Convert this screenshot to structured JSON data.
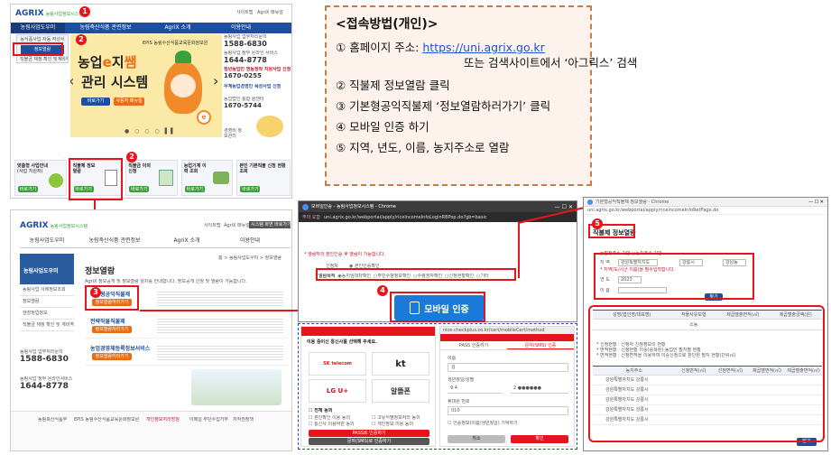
{
  "panel1": {
    "logo": "AGRIX",
    "logo_sub": "농림사업정보시스템",
    "top_links": [
      "사이트맵",
      "AgriX 매뉴얼"
    ],
    "nav": [
      "농림사업도우미",
      "농림축산식품 관련정보",
      "AgriX 소개",
      "이용안내"
    ],
    "dropdown": [
      "농식품사업 자동 작성서",
      "정보열람",
      "직불금 재정 확인 및계비역 관리"
    ],
    "hero_line1": "농업",
    "hero_e": "e",
    "hero_line1b": "지",
    "hero_ssam": "쌤",
    "hero_line2": "관리 시스템",
    "hero_btn1": "바로가기",
    "hero_btn2": "사용자 매뉴얼",
    "hero_brand": "EPIS 농림수산식품교육문화정보원",
    "contact_label1": "농림사업 업무처리문의",
    "contact_phone1": "1588-6830",
    "contact_label2": "농림사업 정부 온라인 서비스",
    "contact_phone2": "1644-8778",
    "contact_label3": "청년농업인 영농정착 지원사업 신청",
    "contact_phone3": "1670-0255",
    "contact_label4": "우계농업경영인 육성사업 신청",
    "contact_label5": "농업법인 통합 콜센터",
    "contact_phone5": "1670-5744",
    "side_icon_label": "경영비 정보관리",
    "tiles": [
      {
        "title": "맞춤형 사업안내",
        "sub": "(사업 지원처)",
        "btn": "바로가기"
      },
      {
        "title": "직불제 정보열람",
        "sub": "",
        "btn": "바로가기"
      },
      {
        "title": "직불금 이의신청",
        "sub": "",
        "btn": "바로가기"
      },
      {
        "title": "농업기계 이력 조회",
        "sub": "",
        "btn": "바로가기"
      },
      {
        "title": "본인 기본직불 신청 현황 조회",
        "sub": "",
        "btn": "바로가기"
      }
    ]
  },
  "panel2": {
    "logo": "AGRIX",
    "logo_sub": "농림사업정보시스템",
    "top_links": [
      "사이트맵",
      "AgriX 매뉴얼",
      "시스템 화면 바로가기"
    ],
    "nav": [
      "농림사업도우미",
      "농림축산식품 관련정보",
      "AgriX 소개",
      "이용안내"
    ],
    "side_title": "농림사업도우미",
    "side_items": [
      "농림사업 사례정보조회",
      "정보열람",
      "현장정업정보",
      "직불금 재정 확인 및 계비역"
    ],
    "content_title": "정보열람",
    "breadcrumb": "홈 > 농림사업도우미 > 정보열람",
    "intro": "AgriX 정보공개 및 정보열람 절차를 안내합니다. 정보공개 신청 및 열람이 가능합니다.",
    "items": [
      {
        "title": "기본형공익직불제",
        "btn": "정보열람하러가기"
      },
      {
        "title": "전략작물직불제",
        "btn": "정보열람하러가기"
      },
      {
        "title": "농업경영체등록정보서비스",
        "btn": "정보열람하러가기"
      }
    ],
    "phone_label1": "농림사업 업무처리문의",
    "phone1": "1588-6830",
    "phone_label2": "농림사업 정부 온라인서비스",
    "phone2": "1644-8778",
    "footer_org1": "농림축산식품부",
    "footer_org2": "EPIS 농림수산식품교육문화정보원",
    "footer_links": [
      "개인정보처리방침",
      "이메일 무단수집거부",
      "저작권정책"
    ]
  },
  "panel3": {
    "window_title": "모바일인증 - 농림사업정보시스템 - Chrome",
    "security": "주의 요함",
    "url": "uni.agrix.go.kr/webportal/apply/ricelncomeInfoLoginRBPop.do?gb=basic",
    "notice": "* 열람자의 본인인증 후 열람이 가능합니다.",
    "radio_label1": "신청자",
    "radio1": "본인인증확인",
    "radio_label2": "열람목적",
    "radios": [
      "농지임대차확인",
      "주민수향정보확인",
      "수령권자확인",
      "신청현황확인",
      "기타"
    ],
    "mobile_btn": "모바일 인증"
  },
  "panel4": {
    "left_logo": "PASS",
    "left_prompt": "이용 중이신 통신사를 선택해 주세요.",
    "carriers": [
      "SK telecom",
      "kt",
      "LG U+",
      "알뜰폰"
    ],
    "agree_all": "전체 동의",
    "agree_items": [
      "본인확인 이용 동의",
      "고유식별정보처리 동의",
      "통신사 이용약관 동의",
      "개인정보 이용 동의"
    ],
    "left_btn": "PASS로 인증하기",
    "left_btn2": "문자(SMS)로 인증하기",
    "url": "nice.checkplus.co.kr/cert/mobileCert/method",
    "tab1": "PASS 인증하기",
    "tab2": "문자(SMS) 인증",
    "field_name": "이름",
    "field_name_val": "김",
    "field_birth": "생년월일/성별",
    "field_birth_val": "9 4",
    "field_birth_mask": "2 ●●●●●●",
    "field_phone": "휴대폰 번호",
    "field_phone_val": "010",
    "remember": "인증정보(이름/생년월일) 기억하기",
    "cancel_btn": "취소",
    "confirm_btn": "확인"
  },
  "panel5": {
    "window_title": "기본형공익직불제 정보열람 - Chrome",
    "url": "uni.agrix.go.kr/webportal/apply/ricelncomeInfoRetPage.do",
    "section_title": "직불제 정보열람",
    "radio1": "법정주소 기반",
    "radio2": "농지주소 기반",
    "label_region": "지  역",
    "region_vals": [
      "강원특별자치도",
      "강릉시",
      "강남동"
    ],
    "region_note": "* 지역(도/시군 이름)을 필수입력합니다.",
    "label_year": "연  도",
    "year_val": "2023",
    "label_name": "이  름",
    "search_btn": "찾기",
    "table1_headers": [
      "성명(법인명/대표명)",
      "작물사유모형",
      "제곱밸출면적(㎡)",
      "제곱밸출금액(원)"
    ],
    "table1_row": [
      "",
      "소농",
      "",
      ""
    ],
    "notes": [
      "* 신청현황 : 신청자 신청정보의 현황",
      "* 면적현황 : 신청현황 이중(중복된) 농업인 필지별 현황",
      "* 면적현황 : 신청면적을 이용하여 이중신청으로 판단된 필지 현황(단위㎡)"
    ],
    "table2_headers": [
      "농지주소",
      "신청면적(㎡)",
      "선정면적(㎡)",
      "제곱밸면적(㎡)",
      "제곱밸출면적(㎡)"
    ],
    "table2_rows": [
      [
        "강원특별자치도 강릉시",
        "",
        "",
        "",
        ""
      ],
      [
        "강원특별자치도 강릉시",
        "",
        "",
        "",
        ""
      ],
      [
        "강원특별자치도 강릉시",
        "",
        "",
        "",
        ""
      ],
      [
        "강원특별자치도 강릉시",
        "",
        "",
        "",
        ""
      ],
      [
        "강원특별자치도 강릉시",
        "",
        "",
        "",
        ""
      ]
    ],
    "close_btn": "닫기"
  },
  "badges": [
    "1",
    "2",
    "2",
    "3",
    "4",
    "5"
  ],
  "guide": {
    "title": "<접속방법(개인)>",
    "step1_num": "①",
    "step1_label": "홈페이지 주소:",
    "step1_link": "https://uni.agrix.go.kr",
    "step1_sub": "또는 검색사이트에서 ‘아그릭스’ 검색",
    "step2": "② 직불제 정보열람 클릭",
    "step3": "③ 기본형공익직불제 ‘정보열람하러가기’ 클릭",
    "step4": "④ 모바일 인증 하기",
    "step5": "⑤ 지역, 년도, 이름, 농지주소로 열람"
  },
  "colors": {
    "accent_red": "#e8141b",
    "agrix_blue": "#1f4e9e",
    "agrix_green": "#3aa03a",
    "guide_bg": "#fdf3ec",
    "guide_border": "#c97a45",
    "mobile_btn": "#1a7ad9"
  }
}
